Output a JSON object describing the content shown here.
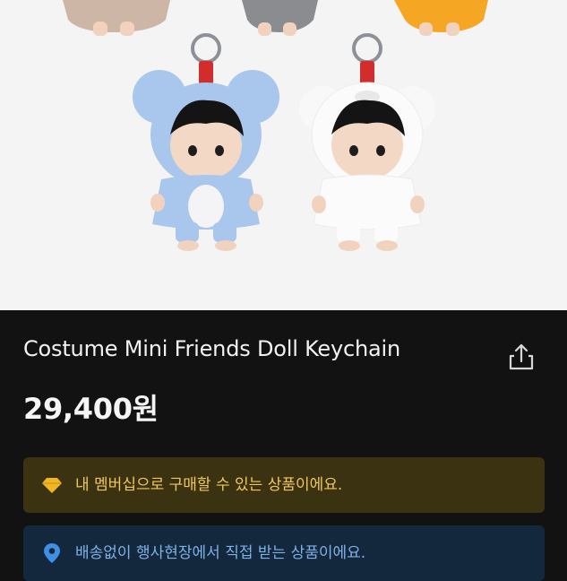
{
  "product": {
    "title": "Costume Mini Friends Doll Keychain",
    "price": "29,400원",
    "image_description_icon": "product-photo"
  },
  "notices": {
    "membership": {
      "text": "내 멤버십으로 구매할 수 있는 상품이에요.",
      "icon": "diamond-icon",
      "color": "#f1b722"
    },
    "location": {
      "text": "배송없이 행사현장에서 직접 받는 상품이에요.",
      "icon": "location-pin-icon",
      "color": "#3e8fe6"
    }
  },
  "actions": {
    "share_icon": "share-icon"
  },
  "colors": {
    "background": "#121212",
    "image_background": "#f5f4f4",
    "membership_bg": "#3b3212",
    "location_bg": "#14283d"
  }
}
